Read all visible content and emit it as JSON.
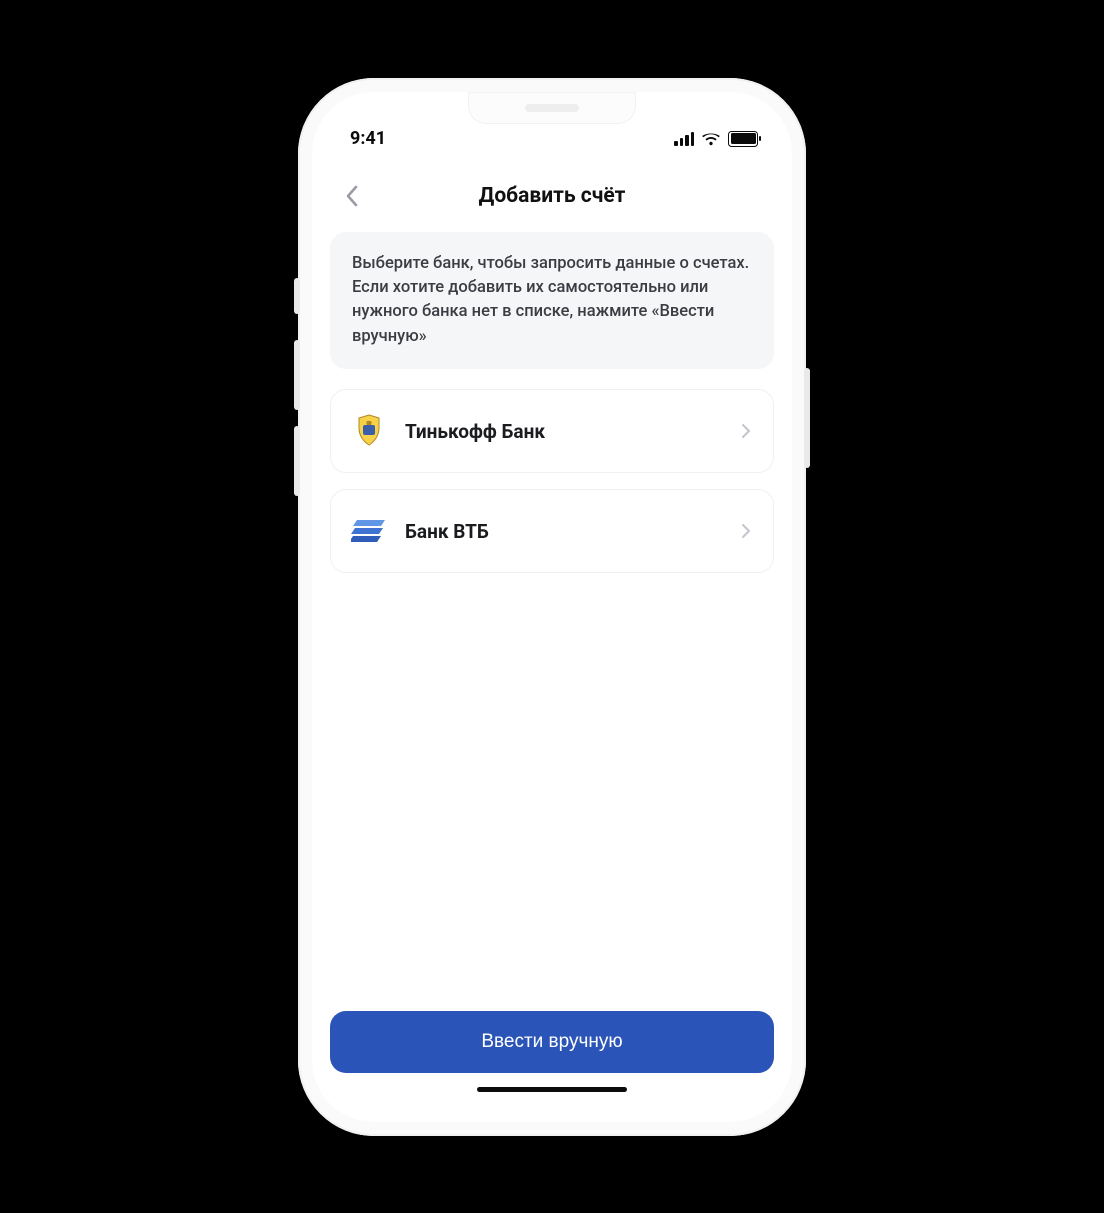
{
  "statusbar": {
    "time": "9:41"
  },
  "navbar": {
    "title": "Добавить счёт"
  },
  "info_card": {
    "text": "Выберите банк, чтобы запросить данные о счетах. Если хотите добавить их самостоятельно или нужного банка нет в списке, нажмите «Ввести вручную»"
  },
  "banks": {
    "items": [
      {
        "name": "Тинькофф Банк",
        "logo": "tinkoff"
      },
      {
        "name": "Банк ВТБ",
        "logo": "vtb"
      }
    ]
  },
  "footer": {
    "primary_label": "Ввести вручную"
  },
  "colors": {
    "primary": "#2b54b8"
  }
}
